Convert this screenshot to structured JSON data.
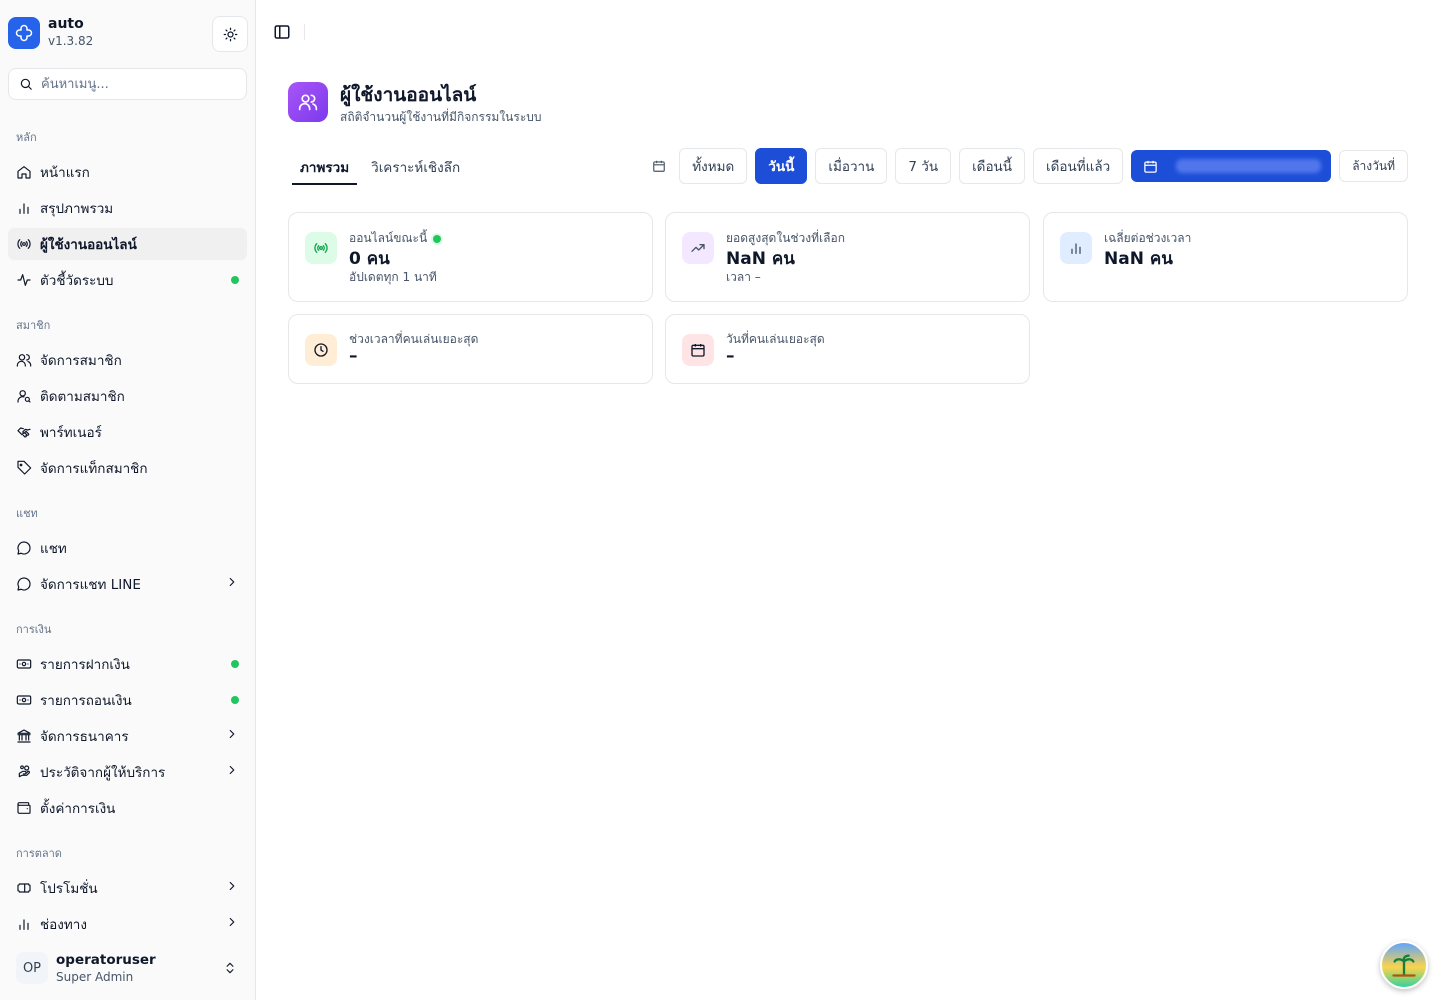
{
  "app": {
    "name": "auto",
    "version": "v1.3.82"
  },
  "search": {
    "placeholder": "ค้นหาเมนู..."
  },
  "nav": {
    "groups": [
      {
        "label": "หลัก",
        "items": [
          {
            "label": "หน้าแรก",
            "icon": "home-icon"
          },
          {
            "label": "สรุปภาพรวม",
            "icon": "bar-chart-icon"
          },
          {
            "label": "ผู้ใช้งานออนไลน์",
            "icon": "radio-icon",
            "active": true
          },
          {
            "label": "ตัวชี้วัดระบบ",
            "icon": "activity-icon",
            "dot": true
          }
        ]
      },
      {
        "label": "สมาชิก",
        "items": [
          {
            "label": "จัดการสมาชิก",
            "icon": "users-icon"
          },
          {
            "label": "ติดตามสมาชิก",
            "icon": "user-search-icon"
          },
          {
            "label": "พาร์ทเนอร์",
            "icon": "handshake-icon"
          },
          {
            "label": "จัดการแท็กสมาชิก",
            "icon": "tag-icon"
          }
        ]
      },
      {
        "label": "แชท",
        "items": [
          {
            "label": "แชท",
            "icon": "message-circle-icon"
          },
          {
            "label": "จัดการแชท LINE",
            "icon": "message-circle-icon",
            "chevron": true
          }
        ]
      },
      {
        "label": "การเงิน",
        "items": [
          {
            "label": "รายการฝากเงิน",
            "icon": "banknote-icon",
            "dot": true
          },
          {
            "label": "รายการถอนเงิน",
            "icon": "banknote-icon",
            "dot": true
          },
          {
            "label": "จัดการธนาคาร",
            "icon": "landmark-icon",
            "chevron": true
          },
          {
            "label": "ประวัติจากผู้ให้บริการ",
            "icon": "hand-coins-icon",
            "chevron": true
          },
          {
            "label": "ตั้งค่าการเงิน",
            "icon": "wallet-icon"
          }
        ]
      },
      {
        "label": "การตลาด",
        "items": [
          {
            "label": "โปรโมชั่น",
            "icon": "ticket-icon",
            "chevron": true
          },
          {
            "label": "ช่องทาง",
            "icon": "bar-chart-icon",
            "chevron": true
          }
        ]
      }
    ]
  },
  "user": {
    "initials": "OP",
    "name": "operatoruser",
    "role": "Super Admin"
  },
  "page": {
    "title": "ผู้ใช้งานออนไลน์",
    "subtitle": "สถิติจำนวนผู้ใช้งานที่มีกิจกรรมในระบบ"
  },
  "tabs": [
    {
      "label": "ภาพรวม",
      "active": true
    },
    {
      "label": "วิเคราะห์เชิงลึก"
    }
  ],
  "filters": {
    "buttons": [
      {
        "label": "ทั้งหมด"
      },
      {
        "label": "วันนี้",
        "active": true
      },
      {
        "label": "เมื่อวาน"
      },
      {
        "label": "7 วัน"
      },
      {
        "label": "เดือนนี้"
      },
      {
        "label": "เดือนที่แล้ว"
      }
    ],
    "clear_label": "ล้างวันที่"
  },
  "cards": {
    "online_now": {
      "title": "ออนไลน์ขณะนี้",
      "value": "0 คน",
      "sub": "อัปเดตทุก 1 นาที",
      "icon": "radio-icon",
      "accent": "#22c55e"
    },
    "peak": {
      "title": "ยอดสูงสุดในช่วงที่เลือก",
      "value": "NaN คน",
      "sub": "เวลา –",
      "icon": "trending-up-icon",
      "accent": "#7c3aed"
    },
    "average": {
      "title": "เฉลี่ยต่อช่วงเวลา",
      "value": "NaN คน",
      "icon": "bar-chart-icon",
      "accent": "#3b82f6"
    },
    "peak_time": {
      "title": "ช่วงเวลาที่คนเล่นเยอะสุด",
      "value": "–",
      "icon": "clock-icon",
      "accent": "#f97316"
    },
    "peak_day": {
      "title": "วันที่คนเล่นเยอะสุด",
      "value": "–",
      "icon": "calendar-icon",
      "accent": "#e11d48"
    }
  },
  "colors": {
    "primary": "#1d4ed8",
    "brand": "#2563eb",
    "success": "#22c55e",
    "page_icon": "#8b5cf6"
  }
}
